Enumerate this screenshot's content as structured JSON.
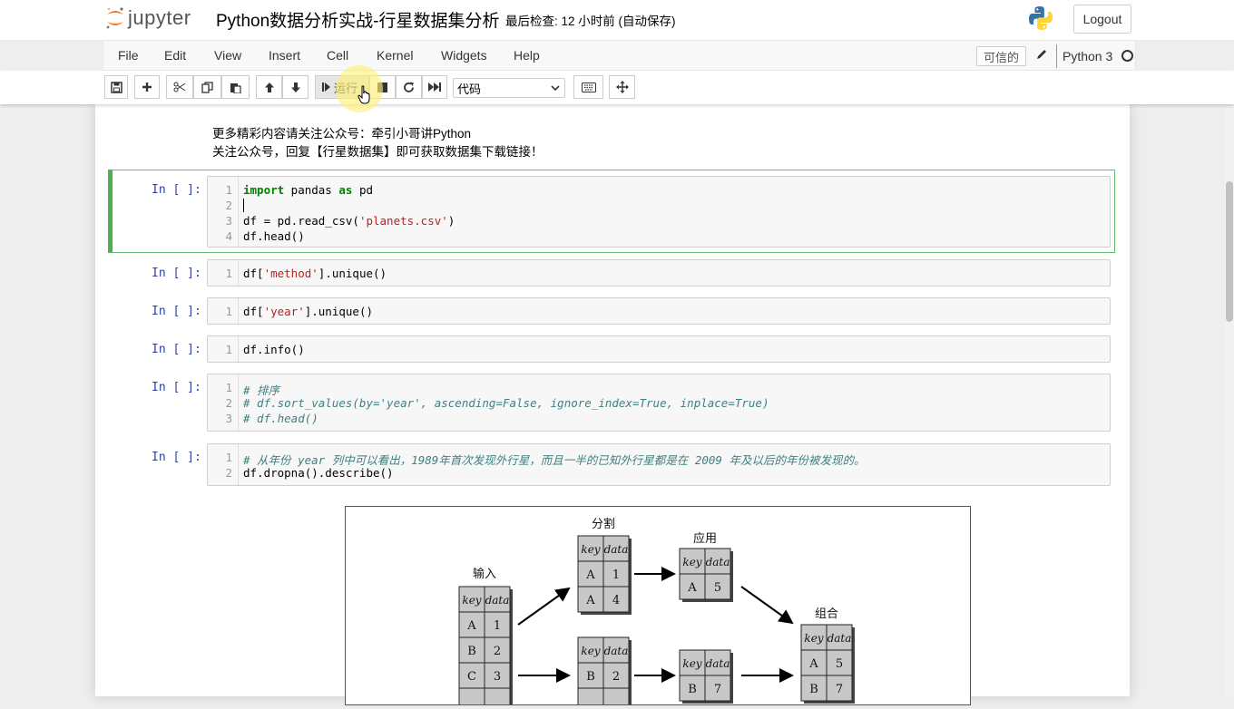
{
  "header": {
    "logo_text": "jupyter",
    "notebook_title": "Python数据分析实战-行星数据集分析",
    "checkpoint": "最后检查: 12 小时前  (自动保存)",
    "logout_label": "Logout"
  },
  "menu": {
    "items": [
      "File",
      "Edit",
      "View",
      "Insert",
      "Cell",
      "Kernel",
      "Widgets",
      "Help"
    ],
    "trusted": "可信的",
    "kernel_name": "Python 3"
  },
  "toolbar": {
    "run_label": "运行",
    "cell_type": "代码"
  },
  "markdown": {
    "line1": "更多精彩内容请关注公众号：牵引小哥讲Python",
    "line2": "关注公众号，回复【行星数据集】即可获取数据集下载链接！"
  },
  "cells": [
    {
      "prompt": "In [ ]:",
      "lines": [
        "import pandas as pd",
        "",
        "df = pd.read_csv('planets.csv')",
        "df.head()"
      ]
    },
    {
      "prompt": "In [ ]:",
      "lines": [
        "df['method'].unique()"
      ]
    },
    {
      "prompt": "In [ ]:",
      "lines": [
        "df['year'].unique()"
      ]
    },
    {
      "prompt": "In [ ]:",
      "lines": [
        "df.info()"
      ]
    },
    {
      "prompt": "In [ ]:",
      "lines": [
        "# 排序",
        "# df.sort_values(by='year', ascending=False, ignore_index=True, inplace=True)",
        "# df.head()"
      ]
    },
    {
      "prompt": "In [ ]:",
      "lines": [
        "# 从年份 year 列中可以看出，1989年首次发现外行星，而且一半的已知外行星都是在 2009 年及以后的年份被发现的。",
        "df.dropna().describe()"
      ]
    }
  ],
  "code_tokens": {
    "c0": {
      "import": "import",
      "pandas": " pandas ",
      "as": "as",
      "pd": " pd",
      "l3a": "df = pd.read_csv(",
      "l3s": "'planets.csv'",
      "l3b": ")",
      "l4": "df.head()"
    },
    "c1": {
      "a": "df[",
      "s": "'method'",
      "b": "].unique()"
    },
    "c2": {
      "a": "df[",
      "s": "'year'",
      "b": "].unique()"
    }
  },
  "figure": {
    "labels": {
      "input": "输入",
      "split": "分割",
      "apply": "应用",
      "combine": "组合"
    },
    "headers": {
      "key": "key",
      "data": "data"
    },
    "input_table": [
      [
        "A",
        "1"
      ],
      [
        "B",
        "2"
      ],
      [
        "C",
        "3"
      ]
    ],
    "split_a": [
      [
        "A",
        "1"
      ],
      [
        "A",
        "4"
      ]
    ],
    "split_b": [
      [
        "B",
        "2"
      ]
    ],
    "apply_a": [
      [
        "A",
        "5"
      ]
    ],
    "apply_b": [
      [
        "B",
        "7"
      ]
    ],
    "combine_table": [
      [
        "A",
        "5"
      ],
      [
        "B",
        "7"
      ]
    ]
  },
  "colors": {
    "accent_green": "#4caf50",
    "prompt_blue": "#303f9f",
    "keyword": "#008000",
    "string": "#ba2121",
    "comment": "#408080"
  }
}
